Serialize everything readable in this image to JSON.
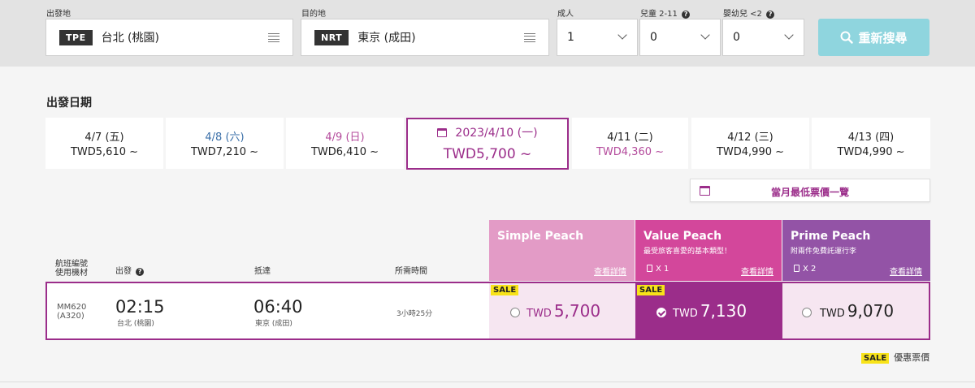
{
  "search": {
    "labels": {
      "origin": "出發地",
      "destination": "目的地",
      "adults": "成人",
      "children": "兒童 2-11",
      "infants": "嬰幼兒 <2"
    },
    "origin": {
      "code": "TPE",
      "city": "台北 (桃園)"
    },
    "destination": {
      "code": "NRT",
      "city": "東京 (成田)"
    },
    "adults_value": "1",
    "children_value": "0",
    "infants_value": "0",
    "button_label": "重新搜尋",
    "help_icon": "?"
  },
  "dates": {
    "title": "出發日期",
    "items": [
      {
        "date": "4/7 (五)",
        "price": "TWD5,610 ~"
      },
      {
        "date": "4/8 (六)",
        "price": "TWD7,210 ~"
      },
      {
        "date": "4/9 (日)",
        "price": "TWD6,410 ~"
      },
      {
        "date": "2023/4/10 (一)",
        "price": "TWD5,700 ~"
      },
      {
        "date": "4/11 (二)",
        "price": "TWD4,360 ~"
      },
      {
        "date": "4/12 (三)",
        "price": "TWD4,990 ~"
      },
      {
        "date": "4/13 (四)",
        "price": "TWD4,990 ~"
      }
    ],
    "lowfare_label": "當月最低票價一覽"
  },
  "colors": {
    "accent": "#9b2d8a",
    "simple": "#e39bc6",
    "value": "#d3479b",
    "prime": "#9353a6",
    "sale": "#f8e319",
    "saturday": "#3a6fa8",
    "sunday": "#b44b9c"
  },
  "columns": {
    "flight": "航班編號",
    "aircraft": "使用機材",
    "depart": "出發",
    "arrive": "抵達",
    "duration": "所需時間"
  },
  "fares": [
    {
      "name": "Simple Peach",
      "subtitle": "",
      "bag": "",
      "detail": "查看詳情"
    },
    {
      "name": "Value Peach",
      "subtitle": "最受旅客喜愛的基本類型！",
      "bag": "X 1",
      "detail": "查看詳情"
    },
    {
      "name": "Prime Peach",
      "subtitle": "附兩件免費託運行李",
      "bag": "X 2",
      "detail": "查看詳情"
    }
  ],
  "flight": {
    "number": "MM620",
    "aircraft": "(A320)",
    "dep_time": "02:15",
    "dep_city": "台北 (桃園)",
    "arr_time": "06:40",
    "arr_city": "東京 (成田)",
    "duration": "3小時25分",
    "prices": [
      {
        "currency": "TWD",
        "amount": "5,700",
        "sale": "SALE",
        "selected": false
      },
      {
        "currency": "TWD",
        "amount": "7,130",
        "sale": "SALE",
        "selected": true
      },
      {
        "currency": "TWD",
        "amount": "9,070",
        "sale": "",
        "selected": false
      }
    ]
  },
  "legend": {
    "badge": "SALE",
    "label": "優惠票價"
  }
}
